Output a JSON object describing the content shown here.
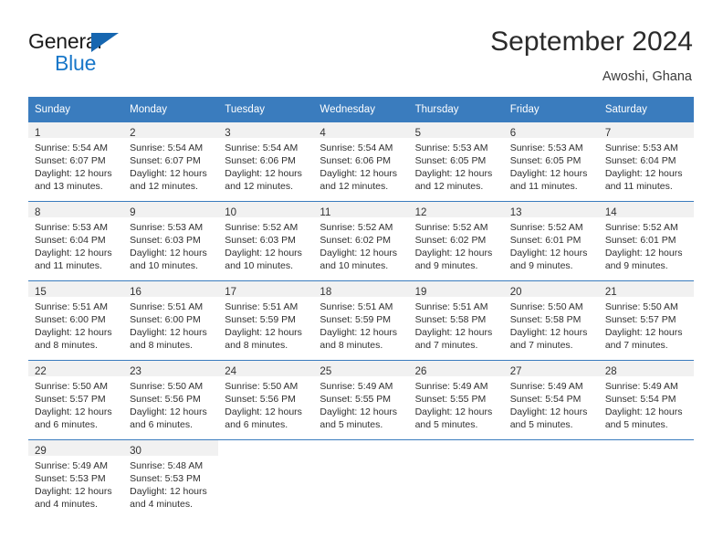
{
  "brand": {
    "name_top": "General",
    "name_bottom": "Blue",
    "triangle_icon": "blue-triangle-icon",
    "accent_color": "#1877c9"
  },
  "header": {
    "title": "September 2024",
    "location": "Awoshi, Ghana"
  },
  "theme": {
    "header_row_bg": "#3a7cbe",
    "daynum_band_bg": "#f1f1f1",
    "row_divider": "#3a7cbe",
    "text": "#2f2f2f"
  },
  "calendar": {
    "weekday_headers": [
      "Sunday",
      "Monday",
      "Tuesday",
      "Wednesday",
      "Thursday",
      "Friday",
      "Saturday"
    ],
    "labels": {
      "sunrise": "Sunrise:",
      "sunset": "Sunset:",
      "daylight": "Daylight:"
    },
    "weeks": [
      [
        {
          "day": "1",
          "sunrise": "Sunrise: 5:54 AM",
          "sunset": "Sunset: 6:07 PM",
          "daylight_line1": "Daylight: 12 hours",
          "daylight_line2": "and 13 minutes."
        },
        {
          "day": "2",
          "sunrise": "Sunrise: 5:54 AM",
          "sunset": "Sunset: 6:07 PM",
          "daylight_line1": "Daylight: 12 hours",
          "daylight_line2": "and 12 minutes."
        },
        {
          "day": "3",
          "sunrise": "Sunrise: 5:54 AM",
          "sunset": "Sunset: 6:06 PM",
          "daylight_line1": "Daylight: 12 hours",
          "daylight_line2": "and 12 minutes."
        },
        {
          "day": "4",
          "sunrise": "Sunrise: 5:54 AM",
          "sunset": "Sunset: 6:06 PM",
          "daylight_line1": "Daylight: 12 hours",
          "daylight_line2": "and 12 minutes."
        },
        {
          "day": "5",
          "sunrise": "Sunrise: 5:53 AM",
          "sunset": "Sunset: 6:05 PM",
          "daylight_line1": "Daylight: 12 hours",
          "daylight_line2": "and 12 minutes."
        },
        {
          "day": "6",
          "sunrise": "Sunrise: 5:53 AM",
          "sunset": "Sunset: 6:05 PM",
          "daylight_line1": "Daylight: 12 hours",
          "daylight_line2": "and 11 minutes."
        },
        {
          "day": "7",
          "sunrise": "Sunrise: 5:53 AM",
          "sunset": "Sunset: 6:04 PM",
          "daylight_line1": "Daylight: 12 hours",
          "daylight_line2": "and 11 minutes."
        }
      ],
      [
        {
          "day": "8",
          "sunrise": "Sunrise: 5:53 AM",
          "sunset": "Sunset: 6:04 PM",
          "daylight_line1": "Daylight: 12 hours",
          "daylight_line2": "and 11 minutes."
        },
        {
          "day": "9",
          "sunrise": "Sunrise: 5:53 AM",
          "sunset": "Sunset: 6:03 PM",
          "daylight_line1": "Daylight: 12 hours",
          "daylight_line2": "and 10 minutes."
        },
        {
          "day": "10",
          "sunrise": "Sunrise: 5:52 AM",
          "sunset": "Sunset: 6:03 PM",
          "daylight_line1": "Daylight: 12 hours",
          "daylight_line2": "and 10 minutes."
        },
        {
          "day": "11",
          "sunrise": "Sunrise: 5:52 AM",
          "sunset": "Sunset: 6:02 PM",
          "daylight_line1": "Daylight: 12 hours",
          "daylight_line2": "and 10 minutes."
        },
        {
          "day": "12",
          "sunrise": "Sunrise: 5:52 AM",
          "sunset": "Sunset: 6:02 PM",
          "daylight_line1": "Daylight: 12 hours",
          "daylight_line2": "and 9 minutes."
        },
        {
          "day": "13",
          "sunrise": "Sunrise: 5:52 AM",
          "sunset": "Sunset: 6:01 PM",
          "daylight_line1": "Daylight: 12 hours",
          "daylight_line2": "and 9 minutes."
        },
        {
          "day": "14",
          "sunrise": "Sunrise: 5:52 AM",
          "sunset": "Sunset: 6:01 PM",
          "daylight_line1": "Daylight: 12 hours",
          "daylight_line2": "and 9 minutes."
        }
      ],
      [
        {
          "day": "15",
          "sunrise": "Sunrise: 5:51 AM",
          "sunset": "Sunset: 6:00 PM",
          "daylight_line1": "Daylight: 12 hours",
          "daylight_line2": "and 8 minutes."
        },
        {
          "day": "16",
          "sunrise": "Sunrise: 5:51 AM",
          "sunset": "Sunset: 6:00 PM",
          "daylight_line1": "Daylight: 12 hours",
          "daylight_line2": "and 8 minutes."
        },
        {
          "day": "17",
          "sunrise": "Sunrise: 5:51 AM",
          "sunset": "Sunset: 5:59 PM",
          "daylight_line1": "Daylight: 12 hours",
          "daylight_line2": "and 8 minutes."
        },
        {
          "day": "18",
          "sunrise": "Sunrise: 5:51 AM",
          "sunset": "Sunset: 5:59 PM",
          "daylight_line1": "Daylight: 12 hours",
          "daylight_line2": "and 8 minutes."
        },
        {
          "day": "19",
          "sunrise": "Sunrise: 5:51 AM",
          "sunset": "Sunset: 5:58 PM",
          "daylight_line1": "Daylight: 12 hours",
          "daylight_line2": "and 7 minutes."
        },
        {
          "day": "20",
          "sunrise": "Sunrise: 5:50 AM",
          "sunset": "Sunset: 5:58 PM",
          "daylight_line1": "Daylight: 12 hours",
          "daylight_line2": "and 7 minutes."
        },
        {
          "day": "21",
          "sunrise": "Sunrise: 5:50 AM",
          "sunset": "Sunset: 5:57 PM",
          "daylight_line1": "Daylight: 12 hours",
          "daylight_line2": "and 7 minutes."
        }
      ],
      [
        {
          "day": "22",
          "sunrise": "Sunrise: 5:50 AM",
          "sunset": "Sunset: 5:57 PM",
          "daylight_line1": "Daylight: 12 hours",
          "daylight_line2": "and 6 minutes."
        },
        {
          "day": "23",
          "sunrise": "Sunrise: 5:50 AM",
          "sunset": "Sunset: 5:56 PM",
          "daylight_line1": "Daylight: 12 hours",
          "daylight_line2": "and 6 minutes."
        },
        {
          "day": "24",
          "sunrise": "Sunrise: 5:50 AM",
          "sunset": "Sunset: 5:56 PM",
          "daylight_line1": "Daylight: 12 hours",
          "daylight_line2": "and 6 minutes."
        },
        {
          "day": "25",
          "sunrise": "Sunrise: 5:49 AM",
          "sunset": "Sunset: 5:55 PM",
          "daylight_line1": "Daylight: 12 hours",
          "daylight_line2": "and 5 minutes."
        },
        {
          "day": "26",
          "sunrise": "Sunrise: 5:49 AM",
          "sunset": "Sunset: 5:55 PM",
          "daylight_line1": "Daylight: 12 hours",
          "daylight_line2": "and 5 minutes."
        },
        {
          "day": "27",
          "sunrise": "Sunrise: 5:49 AM",
          "sunset": "Sunset: 5:54 PM",
          "daylight_line1": "Daylight: 12 hours",
          "daylight_line2": "and 5 minutes."
        },
        {
          "day": "28",
          "sunrise": "Sunrise: 5:49 AM",
          "sunset": "Sunset: 5:54 PM",
          "daylight_line1": "Daylight: 12 hours",
          "daylight_line2": "and 5 minutes."
        }
      ],
      [
        {
          "day": "29",
          "sunrise": "Sunrise: 5:49 AM",
          "sunset": "Sunset: 5:53 PM",
          "daylight_line1": "Daylight: 12 hours",
          "daylight_line2": "and 4 minutes."
        },
        {
          "day": "30",
          "sunrise": "Sunrise: 5:48 AM",
          "sunset": "Sunset: 5:53 PM",
          "daylight_line1": "Daylight: 12 hours",
          "daylight_line2": "and 4 minutes."
        },
        {
          "day": "",
          "sunrise": "",
          "sunset": "",
          "daylight_line1": "",
          "daylight_line2": ""
        },
        {
          "day": "",
          "sunrise": "",
          "sunset": "",
          "daylight_line1": "",
          "daylight_line2": ""
        },
        {
          "day": "",
          "sunrise": "",
          "sunset": "",
          "daylight_line1": "",
          "daylight_line2": ""
        },
        {
          "day": "",
          "sunrise": "",
          "sunset": "",
          "daylight_line1": "",
          "daylight_line2": ""
        },
        {
          "day": "",
          "sunrise": "",
          "sunset": "",
          "daylight_line1": "",
          "daylight_line2": ""
        }
      ]
    ]
  }
}
